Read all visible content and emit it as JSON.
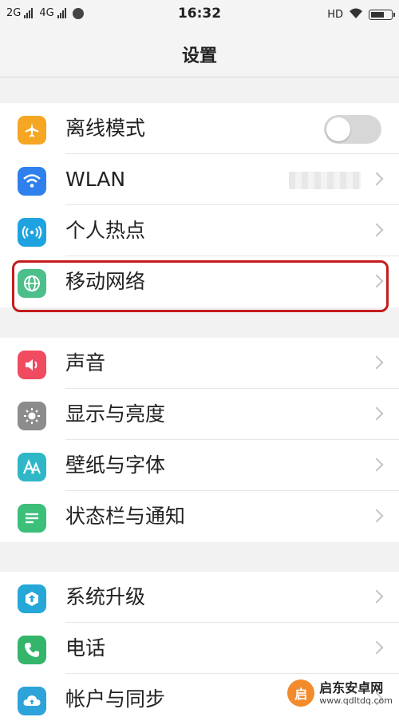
{
  "status_bar": {
    "net1": "2G",
    "net2": "4G",
    "time": "16:32",
    "hd": "HD"
  },
  "header": {
    "title": "设置"
  },
  "groups": [
    {
      "items": [
        {
          "label": "离线模式",
          "icon": "airplane-icon",
          "color": "#f5a623",
          "control": "toggle",
          "toggle_on": false
        },
        {
          "label": "WLAN",
          "icon": "wifi-icon",
          "color": "#2f80ed",
          "control": "chevron",
          "value_blurred": true
        },
        {
          "label": "个人热点",
          "icon": "hotspot-icon",
          "color": "#1fa3e0",
          "control": "chevron"
        },
        {
          "label": "移动网络",
          "icon": "globe-icon",
          "color": "#4cbf8a",
          "control": "chevron",
          "highlighted": true
        }
      ]
    },
    {
      "items": [
        {
          "label": "声音",
          "icon": "speaker-icon",
          "color": "#f04b5f",
          "control": "chevron"
        },
        {
          "label": "显示与亮度",
          "icon": "brightness-icon",
          "color": "#8c8c8c",
          "control": "chevron"
        },
        {
          "label": "壁纸与字体",
          "icon": "font-icon",
          "color": "#2fb7c7",
          "control": "chevron"
        },
        {
          "label": "状态栏与通知",
          "icon": "list-icon",
          "color": "#3cbf79",
          "control": "chevron"
        }
      ]
    },
    {
      "items": [
        {
          "label": "系统升级",
          "icon": "upgrade-icon",
          "color": "#25a7d8",
          "control": "chevron"
        },
        {
          "label": "电话",
          "icon": "phone-icon",
          "color": "#35b56a",
          "control": "chevron"
        },
        {
          "label": "帐户与同步",
          "icon": "cloud-sync-icon",
          "color": "#2ea3da",
          "control": "chevron"
        }
      ]
    }
  ],
  "watermark": {
    "name": "启东安卓网",
    "url": "www.qdltdq.com",
    "logo_char": "启"
  }
}
